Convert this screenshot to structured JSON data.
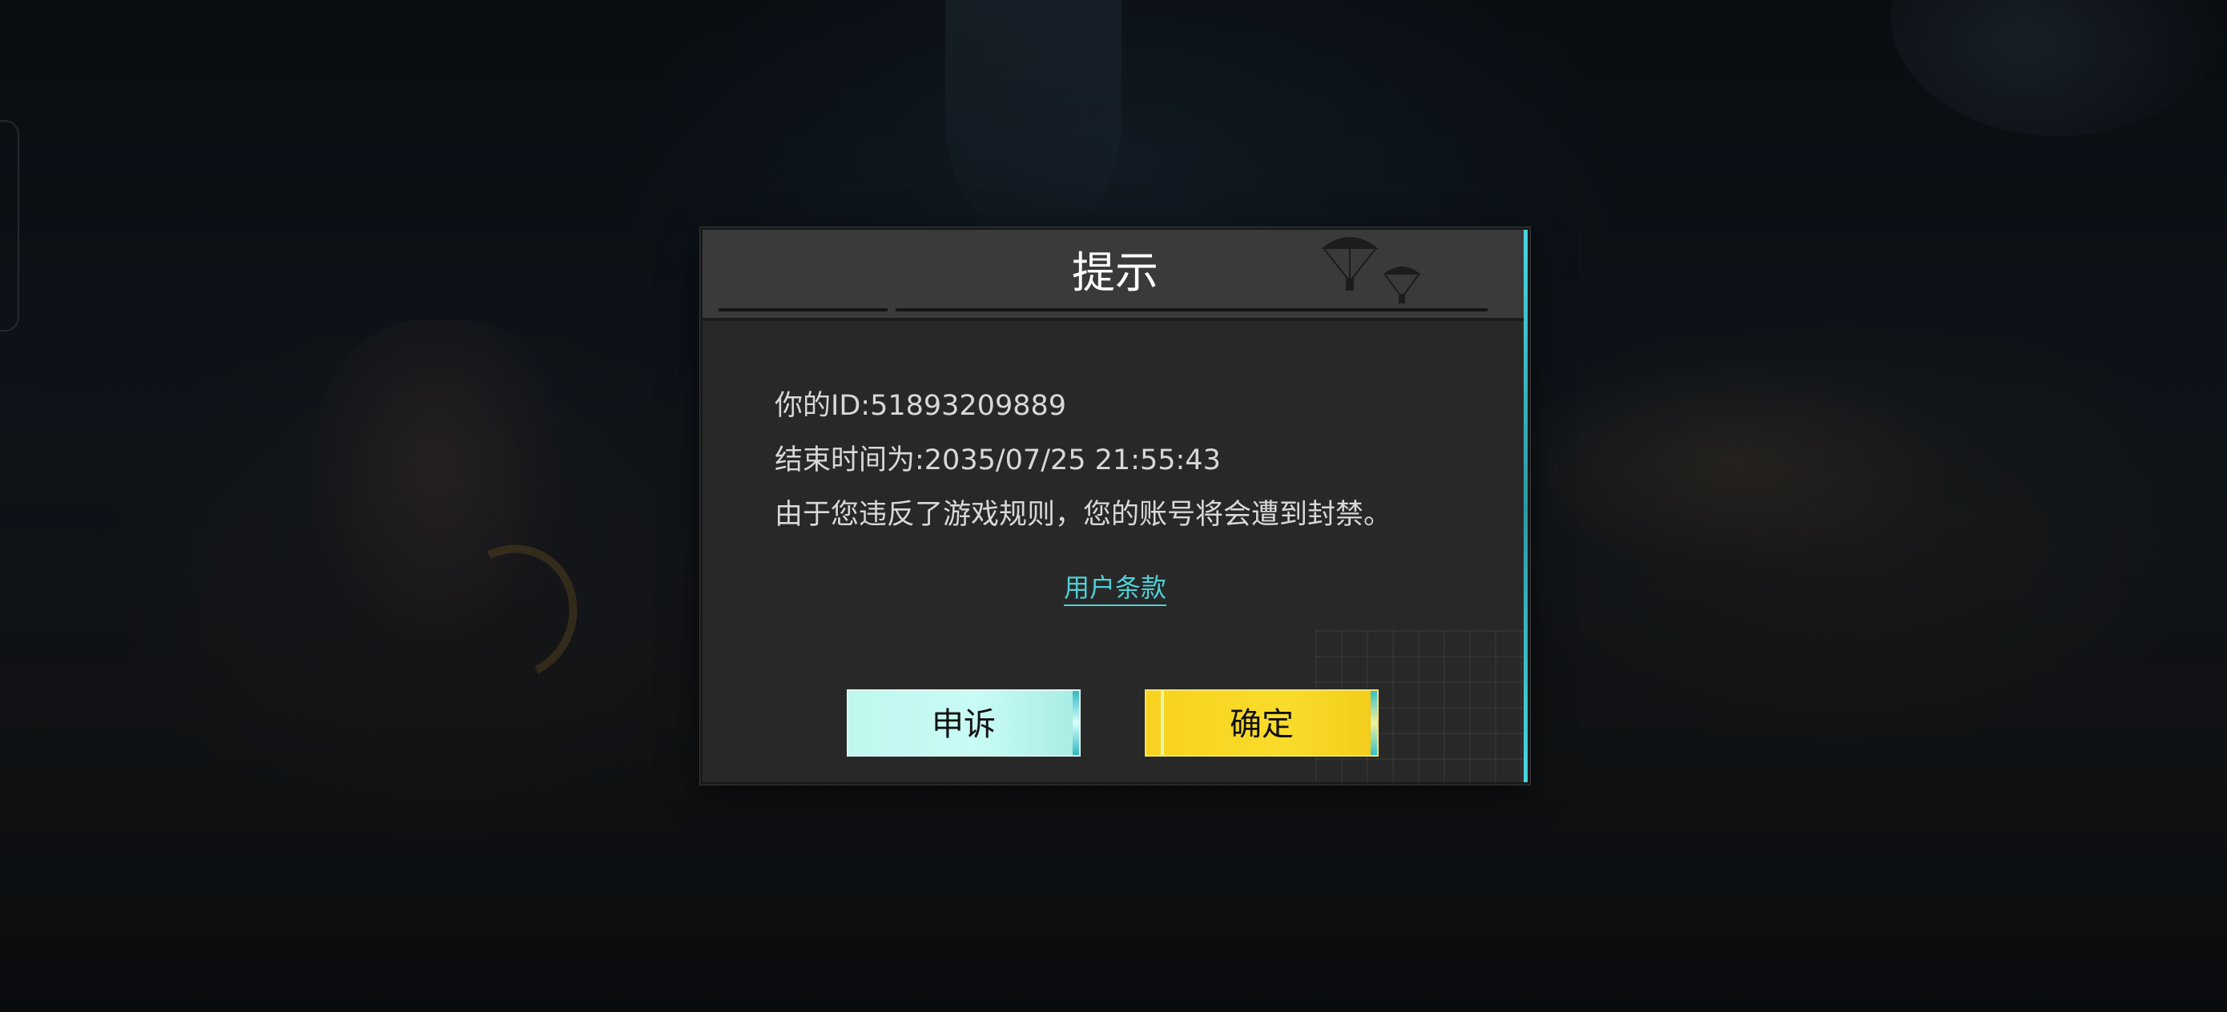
{
  "dialog": {
    "title": "提示",
    "id_line": "你的ID:51893209889",
    "end_time_line": "结束时间为:2035/07/25 21:55:43",
    "message": "由于您违反了游戏规则，您的账号将会遭到封禁。",
    "terms_link": "用户条款",
    "appeal_button": "申诉",
    "confirm_button": "确定"
  },
  "colors": {
    "dialog_bg": "#282828",
    "header_bg": "#3a3a3a",
    "accent": "#48d6e0",
    "appeal_button": "#c8fbf6",
    "confirm_button": "#f9dc2a",
    "link": "#4fcfd6"
  },
  "icons": [
    "parachute-icon"
  ]
}
